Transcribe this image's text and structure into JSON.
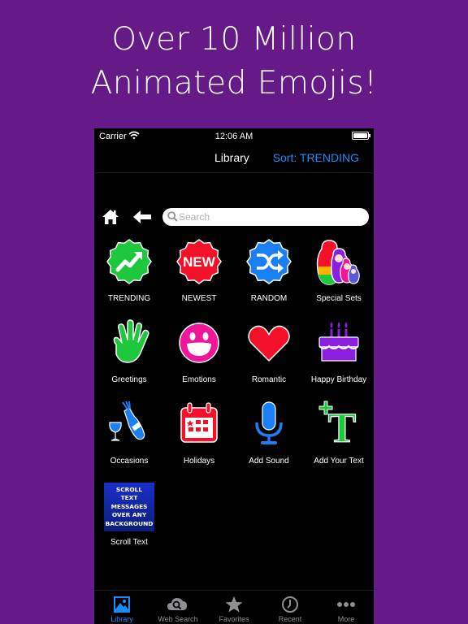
{
  "headline": {
    "line1": "Over 10 Million",
    "line2": "Animated Emojis!"
  },
  "status_bar": {
    "carrier": "Carrier",
    "time": "12:06 AM"
  },
  "nav": {
    "title": "Library",
    "sort_button": "Sort: TRENDING"
  },
  "search": {
    "placeholder": "Search",
    "value": ""
  },
  "categories": [
    {
      "label": "TRENDING",
      "icon": "trending-badge-icon"
    },
    {
      "label": "NEWEST",
      "icon": "new-badge-icon",
      "badge_text": "NEW"
    },
    {
      "label": "RANDOM",
      "icon": "shuffle-badge-icon"
    },
    {
      "label": "Special Sets",
      "icon": "nesting-dolls-icon"
    },
    {
      "label": "Greetings",
      "icon": "waving-hand-icon"
    },
    {
      "label": "Emotions",
      "icon": "smiley-face-icon"
    },
    {
      "label": "Romantic",
      "icon": "heart-icon"
    },
    {
      "label": "Happy Birthday",
      "icon": "birthday-cake-icon"
    },
    {
      "label": "Occasions",
      "icon": "champagne-icon"
    },
    {
      "label": "Holidays",
      "icon": "calendar-icon"
    },
    {
      "label": "Add Sound",
      "icon": "microphone-icon"
    },
    {
      "label": "Add Your Text",
      "icon": "add-text-icon"
    },
    {
      "label": "Scroll Text",
      "icon": "scroll-text-thumbnail",
      "thumb_lines": [
        "SCROLL",
        "TEXT",
        "MESSAGES",
        "OVER ANY",
        "BACKGROUND"
      ]
    }
  ],
  "tabs": [
    {
      "label": "Library",
      "icon": "photo-library-icon",
      "active": true
    },
    {
      "label": "Web Search",
      "icon": "cloud-search-icon",
      "active": false
    },
    {
      "label": "Favorites",
      "icon": "star-icon",
      "active": false
    },
    {
      "label": "Recent",
      "icon": "clock-icon",
      "active": false
    },
    {
      "label": "More",
      "icon": "more-dots-icon",
      "active": false
    }
  ],
  "colors": {
    "background": "#651a87",
    "accent": "#1a8cff",
    "trending": "#1ec83c",
    "newest": "#f5102a",
    "random": "#1a7ff5",
    "emotions": "#f0159a",
    "birthday": "#8a1fe0"
  }
}
